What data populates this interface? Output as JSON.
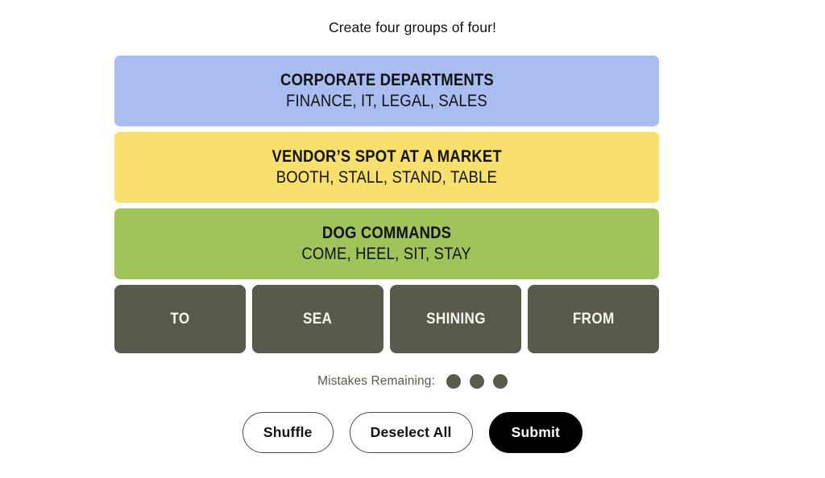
{
  "board": {
    "title": "Create four groups of four!",
    "solved_groups": [
      {
        "category": "CORPORATE DEPARTMENTS",
        "members": "FINANCE, IT, LEGAL, SALES",
        "color": "#aabdf0"
      },
      {
        "category": "VENDOR’S SPOT AT A MARKET",
        "members": "BOOTH, STALL, STAND, TABLE",
        "color": "#f9df6d"
      },
      {
        "category": "DOG COMMANDS",
        "members": "COME, HEEL, SIT, STAY",
        "color": "#a0c35a"
      }
    ],
    "tiles": [
      {
        "label": "TO"
      },
      {
        "label": "SEA"
      },
      {
        "label": "SHINING"
      },
      {
        "label": "FROM"
      }
    ],
    "tile_color": "#5a5a4c"
  },
  "mistakes": {
    "label": "Mistakes Remaining:",
    "remaining": 3,
    "dot_color": "#5a5a4c"
  },
  "controls": {
    "shuffle_label": "Shuffle",
    "deselect_label": "Deselect All",
    "submit_label": "Submit",
    "submit_bg": "#000000"
  }
}
